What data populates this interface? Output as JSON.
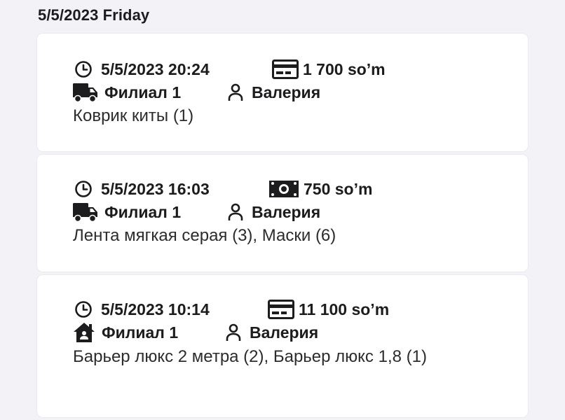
{
  "date_header": "5/5/2023 Friday",
  "orders": [
    {
      "time": "5/5/2023 20:24",
      "payment_icon": "credit-card-icon",
      "amount": "1 700 so’m",
      "delivery_icon": "truck-icon",
      "branch": "Филиал 1",
      "user_icon": "person-icon",
      "user": "Валерия",
      "items": "Коврик киты  (1)"
    },
    {
      "time": "5/5/2023 16:03",
      "payment_icon": "cash-icon",
      "amount": "750 so’m",
      "delivery_icon": "truck-icon",
      "branch": "Филиал 1",
      "user_icon": "person-icon",
      "user": "Валерия",
      "items": "Лента мягкая серая  (3), Маски  (6)"
    },
    {
      "time": "5/5/2023 10:14",
      "payment_icon": "credit-card-icon",
      "amount": "11 100 so’m",
      "delivery_icon": "home-icon",
      "branch": "Филиал 1",
      "user_icon": "person-icon",
      "user": "Валерия",
      "items": "Барьер люкс 2 метра (2), Барьер люкс 1,8 (1)"
    }
  ],
  "colors": {
    "background": "#f2f2f7",
    "card": "#ffffff",
    "text": "#1c1c1e"
  }
}
